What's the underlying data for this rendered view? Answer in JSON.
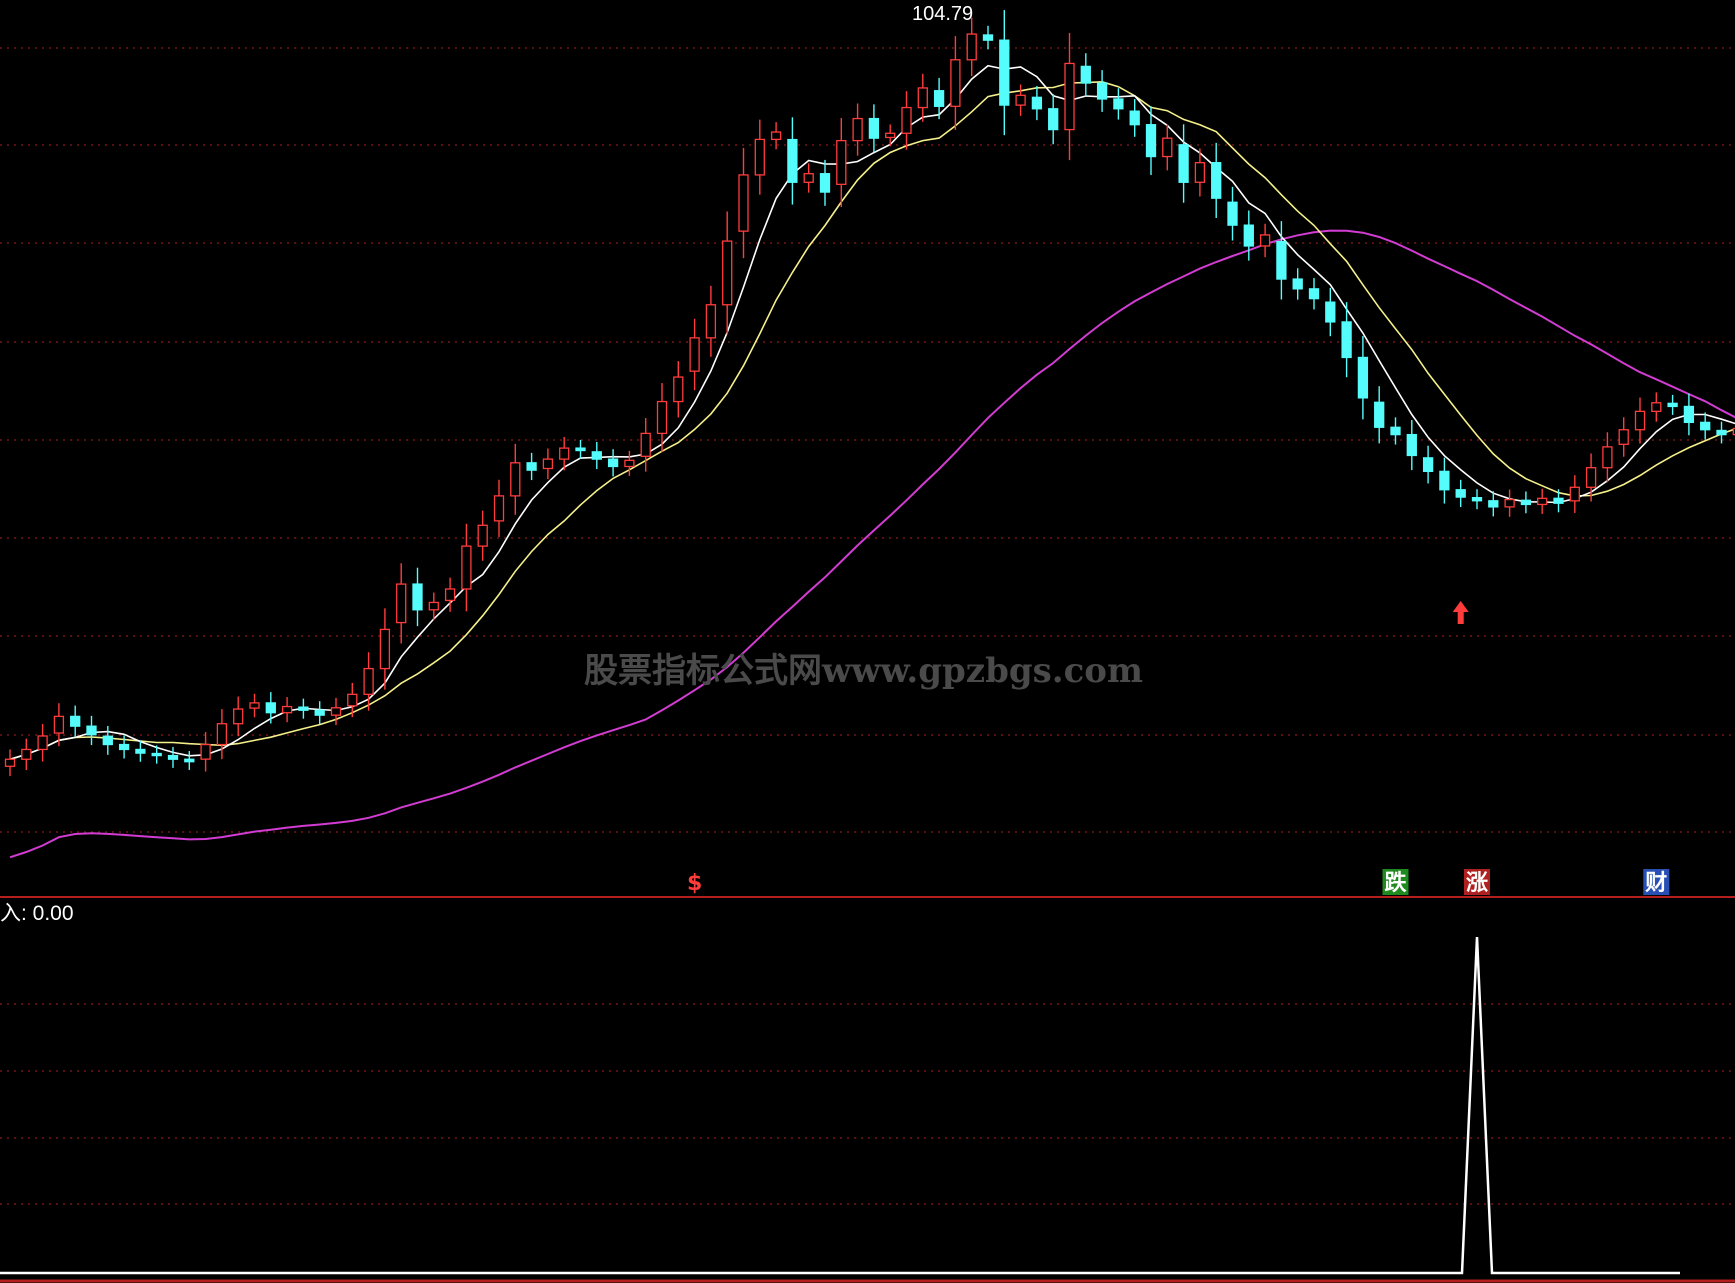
{
  "theme": {
    "background": "#000000",
    "up_color": "#ff3c3c",
    "down_color": "#54fcfc",
    "grid_color": "#8b1a1a",
    "ma5_color": "#ffffff",
    "ma10_color": "#f5f08a",
    "ma60_color": "#d23cd2",
    "panel_divider_color": "#b41e1e"
  },
  "main_panel": {
    "peak_label": "104.79",
    "watermark": "股票指标公式网www.gpzbgs.com",
    "markers": [
      {
        "text": "$",
        "bar": 42,
        "color": "#ff3c3c",
        "bg": ""
      },
      {
        "text": "跌",
        "bar": 85,
        "color": "#ffffff",
        "bg": "#1f8a1f"
      },
      {
        "text": "涨",
        "bar": 90,
        "color": "#ffffff",
        "bg": "#b02020"
      },
      {
        "text": "财",
        "bar": 101,
        "color": "#ffffff",
        "bg": "#2850b4"
      }
    ],
    "buy_arrow_bar": 89
  },
  "sub_panel": {
    "label": "入: 0.00"
  },
  "chart_data": {
    "type": "candlestick",
    "bars": 106,
    "y_peak": 104.79,
    "candles_close": [
      45.0,
      45.8,
      46.9,
      48.5,
      47.7,
      47.0,
      46.2,
      45.8,
      45.5,
      45.3,
      45.0,
      44.8,
      46.2,
      47.9,
      49.1,
      49.6,
      48.8,
      49.3,
      49.0,
      48.6,
      49.2,
      50.3,
      52.4,
      55.6,
      59.3,
      57.2,
      57.8,
      58.9,
      62.4,
      64.1,
      66.5,
      69.2,
      68.6,
      69.5,
      70.4,
      70.2,
      69.5,
      68.9,
      69.4,
      71.6,
      74.2,
      76.2,
      79.4,
      82.1,
      87.3,
      92.7,
      95.6,
      96.2,
      92.1,
      92.8,
      91.3,
      95.5,
      97.3,
      95.7,
      96.1,
      98.2,
      99.8,
      98.3,
      102.1,
      104.2,
      103.7,
      98.4,
      99.2,
      98.1,
      96.4,
      101.8,
      100.2,
      98.9,
      98.1,
      96.8,
      94.2,
      95.7,
      92.1,
      93.7,
      90.8,
      88.6,
      86.9,
      87.8,
      84.2,
      83.4,
      82.6,
      80.7,
      77.8,
      74.5,
      72.1,
      71.5,
      69.8,
      68.5,
      67.0,
      66.4,
      66.1,
      65.6,
      66.2,
      65.8,
      66.3,
      65.9,
      67.2,
      68.8,
      70.5,
      71.9,
      73.4,
      74.1,
      73.8,
      72.5,
      71.9,
      71.5,
      72.0
    ],
    "sub_indicator": {
      "name": "入",
      "value": 0.0,
      "spike_bar": 90,
      "spike_value": 1
    }
  }
}
